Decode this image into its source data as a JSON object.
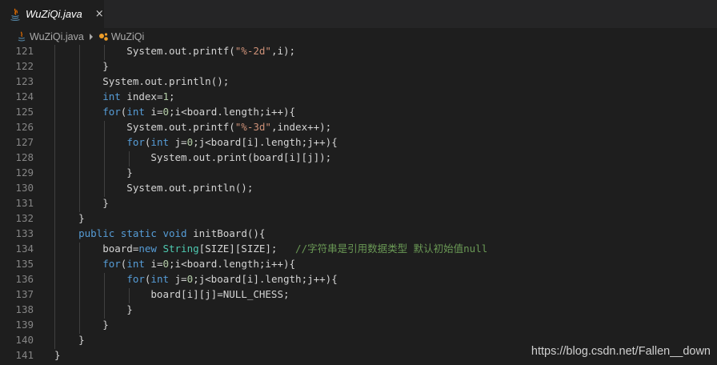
{
  "tab": {
    "title": "WuZiQi.java",
    "close_glyph": "×"
  },
  "breadcrumb": {
    "file": "WuZiQi.java",
    "class_name": "WuZiQi"
  },
  "colors": {
    "keyword": "#569cd6",
    "string": "#ce9178",
    "number": "#b5cea8",
    "comment": "#6a9955",
    "type": "#4ec9b0",
    "plain": "#d4d4d4",
    "line_number": "#858585"
  },
  "code_lines": [
    {
      "number": "121",
      "segments": [
        [
          "            System.out.printf(",
          "plain"
        ],
        [
          "\"%-2d\"",
          "string"
        ],
        [
          ",i);",
          "plain"
        ]
      ]
    },
    {
      "number": "122",
      "segments": [
        [
          "        }",
          "plain"
        ]
      ]
    },
    {
      "number": "123",
      "segments": [
        [
          "        System.out.println();",
          "plain"
        ]
      ]
    },
    {
      "number": "124",
      "segments": [
        [
          "        ",
          "plain"
        ],
        [
          "int",
          "keyword"
        ],
        [
          " index=",
          "plain"
        ],
        [
          "1",
          "number"
        ],
        [
          ";",
          "plain"
        ]
      ]
    },
    {
      "number": "125",
      "segments": [
        [
          "        ",
          "plain"
        ],
        [
          "for",
          "keyword"
        ],
        [
          "(",
          "plain"
        ],
        [
          "int",
          "keyword"
        ],
        [
          " i=",
          "plain"
        ],
        [
          "0",
          "number"
        ],
        [
          ";i<board.length;i++){",
          "plain"
        ]
      ]
    },
    {
      "number": "126",
      "segments": [
        [
          "            System.out.printf(",
          "plain"
        ],
        [
          "\"%-3d\"",
          "string"
        ],
        [
          ",index++);",
          "plain"
        ]
      ]
    },
    {
      "number": "127",
      "segments": [
        [
          "            ",
          "plain"
        ],
        [
          "for",
          "keyword"
        ],
        [
          "(",
          "plain"
        ],
        [
          "int",
          "keyword"
        ],
        [
          " j=",
          "plain"
        ],
        [
          "0",
          "number"
        ],
        [
          ";j<board[i].length;j++){",
          "plain"
        ]
      ]
    },
    {
      "number": "128",
      "segments": [
        [
          "                System.out.print(board[i][j]);",
          "plain"
        ]
      ]
    },
    {
      "number": "129",
      "segments": [
        [
          "            }",
          "plain"
        ]
      ]
    },
    {
      "number": "130",
      "segments": [
        [
          "            System.out.println();",
          "plain"
        ]
      ]
    },
    {
      "number": "131",
      "segments": [
        [
          "        }",
          "plain"
        ]
      ]
    },
    {
      "number": "132",
      "segments": [
        [
          "    }",
          "plain"
        ]
      ]
    },
    {
      "number": "133",
      "segments": [
        [
          "    ",
          "plain"
        ],
        [
          "public",
          "keyword"
        ],
        [
          " ",
          "plain"
        ],
        [
          "static",
          "keyword"
        ],
        [
          " ",
          "plain"
        ],
        [
          "void",
          "keyword"
        ],
        [
          " initBoard(){",
          "plain"
        ]
      ]
    },
    {
      "number": "134",
      "segments": [
        [
          "        board=",
          "plain"
        ],
        [
          "new",
          "keyword"
        ],
        [
          " ",
          "plain"
        ],
        [
          "String",
          "type"
        ],
        [
          "[SIZE][SIZE];   ",
          "plain"
        ],
        [
          "//字符串是引用数据类型 默认初始值null",
          "comment"
        ]
      ]
    },
    {
      "number": "135",
      "segments": [
        [
          "        ",
          "plain"
        ],
        [
          "for",
          "keyword"
        ],
        [
          "(",
          "plain"
        ],
        [
          "int",
          "keyword"
        ],
        [
          " i=",
          "plain"
        ],
        [
          "0",
          "number"
        ],
        [
          ";i<board.length;i++){",
          "plain"
        ]
      ]
    },
    {
      "number": "136",
      "segments": [
        [
          "            ",
          "plain"
        ],
        [
          "for",
          "keyword"
        ],
        [
          "(",
          "plain"
        ],
        [
          "int",
          "keyword"
        ],
        [
          " j=",
          "plain"
        ],
        [
          "0",
          "number"
        ],
        [
          ";j<board[i].length;j++){",
          "plain"
        ]
      ]
    },
    {
      "number": "137",
      "segments": [
        [
          "                board[i][j]=NULL_CHESS;",
          "plain"
        ]
      ]
    },
    {
      "number": "138",
      "segments": [
        [
          "            }",
          "plain"
        ]
      ]
    },
    {
      "number": "139",
      "segments": [
        [
          "        }",
          "plain"
        ]
      ]
    },
    {
      "number": "140",
      "segments": [
        [
          "    }",
          "plain"
        ]
      ]
    },
    {
      "number": "141",
      "segments": [
        [
          "}",
          "plain"
        ]
      ]
    }
  ],
  "watermark": "https://blog.csdn.net/Fallen__down"
}
